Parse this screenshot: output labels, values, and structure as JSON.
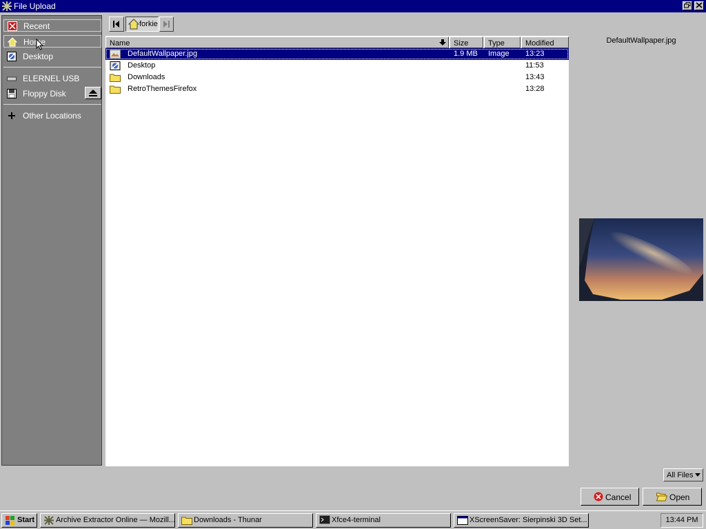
{
  "window": {
    "title": "File Upload"
  },
  "sidebar": {
    "items": [
      {
        "label": "Recent",
        "icon": "recent-icon"
      },
      {
        "label": "Home",
        "icon": "home-icon"
      },
      {
        "label": "Desktop",
        "icon": "desktop-icon"
      },
      {
        "label": "ELERNEL USB",
        "icon": "usb-drive-icon"
      },
      {
        "label": "Floppy Disk",
        "icon": "floppy-icon"
      },
      {
        "label": "Other Locations",
        "icon": "plus-icon"
      }
    ]
  },
  "path": {
    "current": "forkie"
  },
  "columns": {
    "name": "Name",
    "size": "Size",
    "type": "Type",
    "modified": "Modified"
  },
  "files": [
    {
      "name": "DefaultWallpaper.jpg",
      "size": "1.9 MB",
      "type": "Image",
      "modified": "13:23",
      "icon": "image-file-icon"
    },
    {
      "name": "Desktop",
      "size": "",
      "type": "",
      "modified": "11:53",
      "icon": "desktop-folder-icon"
    },
    {
      "name": "Downloads",
      "size": "",
      "type": "",
      "modified": "13:43",
      "icon": "folder-icon"
    },
    {
      "name": "RetroThemesFirefox",
      "size": "",
      "type": "",
      "modified": "13:28",
      "icon": "folder-icon"
    }
  ],
  "preview": {
    "filename": "DefaultWallpaper.jpg"
  },
  "filter": {
    "selected": "All Files"
  },
  "buttons": {
    "cancel": "Cancel",
    "open": "Open"
  },
  "taskbar": {
    "start": "Start",
    "tasks": [
      {
        "label": "Archive Extractor Online — Mozill..."
      },
      {
        "label": "Downloads - Thunar"
      },
      {
        "label": "Xfce4-terminal"
      },
      {
        "label": "XScreenSaver: Sierpinski 3D Set..."
      }
    ],
    "clock": "13:44 PM"
  },
  "colors": {
    "titlebar": "#000080",
    "selection": "#000080",
    "face": "#c0c0c0",
    "sidebar": "#808080"
  }
}
